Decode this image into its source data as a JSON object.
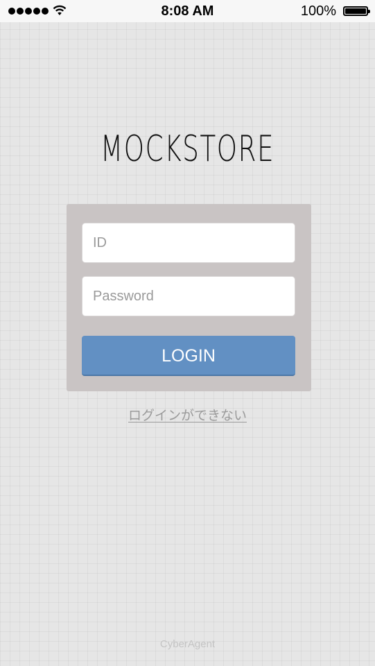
{
  "status_bar": {
    "time": "8:08 AM",
    "battery_percent": "100%",
    "signal_bars": 5,
    "icons": [
      "signal-icon",
      "wifi-icon",
      "battery-icon"
    ]
  },
  "app": {
    "logo_text": "MOCKSTORE"
  },
  "login_form": {
    "id_field": {
      "placeholder": "ID",
      "value": ""
    },
    "password_field": {
      "placeholder": "Password",
      "value": ""
    },
    "login_label": "LOGIN",
    "forgot_link": "ログインができない"
  },
  "footer": {
    "brand": "CyberAgent"
  },
  "colors": {
    "background": "#e6e6e6",
    "panel": "#c9c4c4",
    "login_button": "#6290c3",
    "link": "#9a9a9a"
  }
}
